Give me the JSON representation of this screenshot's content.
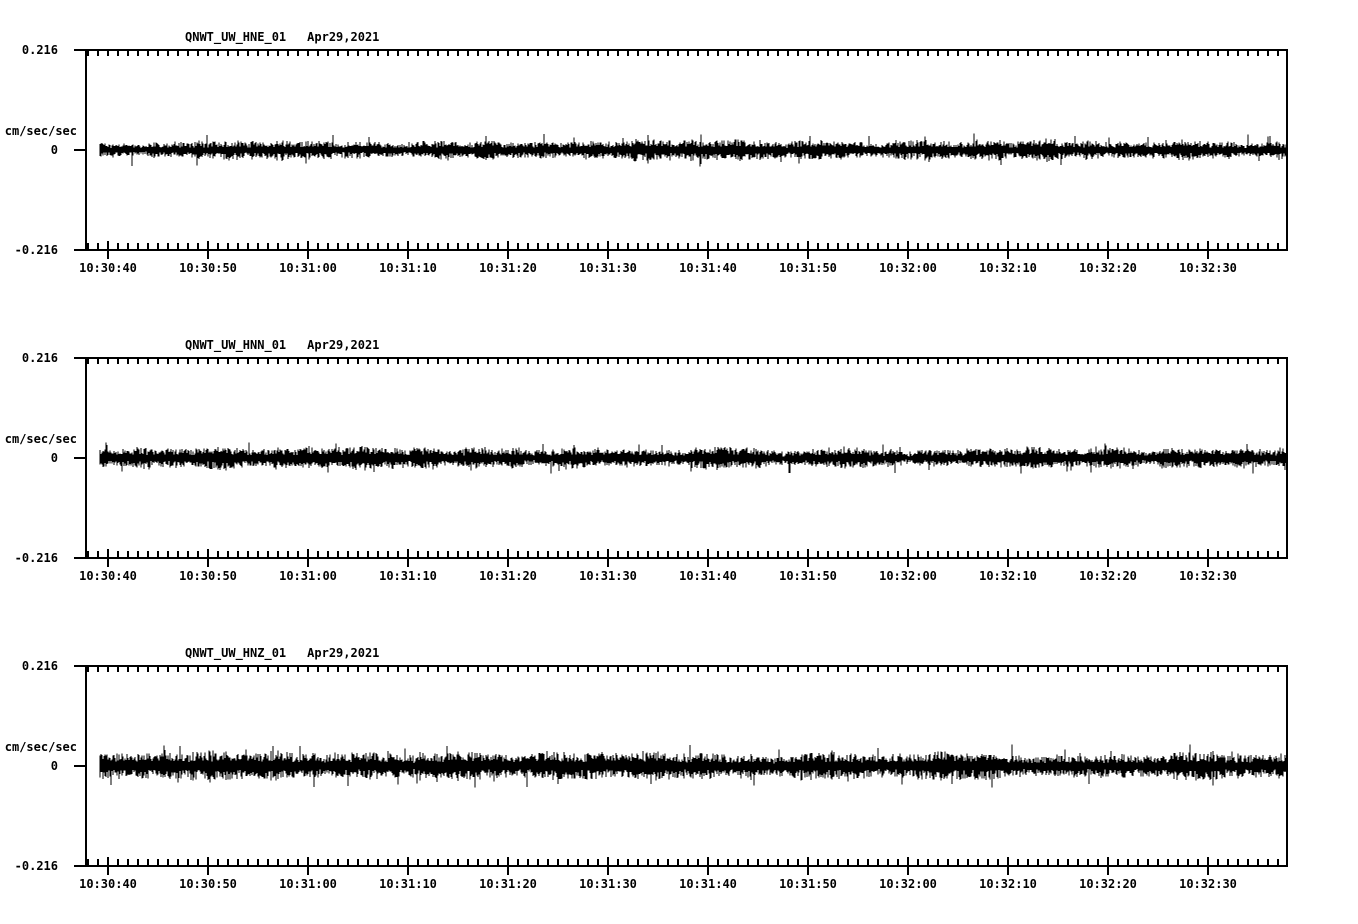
{
  "colors": {
    "background": "#ffffff",
    "ink": "#000000"
  },
  "chart_data": [
    {
      "type": "line",
      "title": "QNWT_UW_HNE_01",
      "date": "Apr29,2021",
      "ylabel": "cm/sec/sec",
      "ylim": [
        -0.216,
        0.216
      ],
      "ytick_labels": [
        "0.216",
        "0",
        "-0.216"
      ],
      "xtick_labels": [
        "10:30:40",
        "10:30:50",
        "10:31:00",
        "10:31:10",
        "10:31:20",
        "10:31:30",
        "10:31:40",
        "10:31:50",
        "10:32:00",
        "10:32:10",
        "10:32:20",
        "10:32:30"
      ],
      "x_minor_tick_seconds": 1,
      "x_major_tick_seconds": 10,
      "x_span_seconds": 120,
      "grid": false,
      "legend": "none",
      "series": [
        {
          "name": "HNE",
          "kind": "continuous seismic background noise",
          "baseline": 0,
          "typical_amplitude": 0.015,
          "peak_amplitude": 0.036
        }
      ]
    },
    {
      "type": "line",
      "title": "QNWT_UW_HNN_01",
      "date": "Apr29,2021",
      "ylabel": "cm/sec/sec",
      "ylim": [
        -0.216,
        0.216
      ],
      "ytick_labels": [
        "0.216",
        "0",
        "-0.216"
      ],
      "xtick_labels": [
        "10:30:40",
        "10:30:50",
        "10:31:00",
        "10:31:10",
        "10:31:20",
        "10:31:30",
        "10:31:40",
        "10:31:50",
        "10:32:00",
        "10:32:10",
        "10:32:20",
        "10:32:30"
      ],
      "x_minor_tick_seconds": 1,
      "x_major_tick_seconds": 10,
      "x_span_seconds": 120,
      "grid": false,
      "legend": "none",
      "series": [
        {
          "name": "HNN",
          "kind": "continuous seismic background noise",
          "baseline": 0,
          "typical_amplitude": 0.016,
          "peak_amplitude": 0.034
        }
      ]
    },
    {
      "type": "line",
      "title": "QNWT_UW_HNZ_01",
      "date": "Apr29,2021",
      "ylabel": "cm/sec/sec",
      "ylim": [
        -0.216,
        0.216
      ],
      "ytick_labels": [
        "0.216",
        "0",
        "-0.216"
      ],
      "xtick_labels": [
        "10:30:40",
        "10:30:50",
        "10:31:00",
        "10:31:10",
        "10:31:20",
        "10:31:30",
        "10:31:40",
        "10:31:50",
        "10:32:00",
        "10:32:10",
        "10:32:20",
        "10:32:30"
      ],
      "x_minor_tick_seconds": 1,
      "x_major_tick_seconds": 10,
      "x_span_seconds": 120,
      "grid": false,
      "legend": "none",
      "series": [
        {
          "name": "HNZ",
          "kind": "continuous seismic background noise",
          "baseline": 0,
          "typical_amplitude": 0.021,
          "peak_amplitude": 0.047
        }
      ]
    }
  ]
}
